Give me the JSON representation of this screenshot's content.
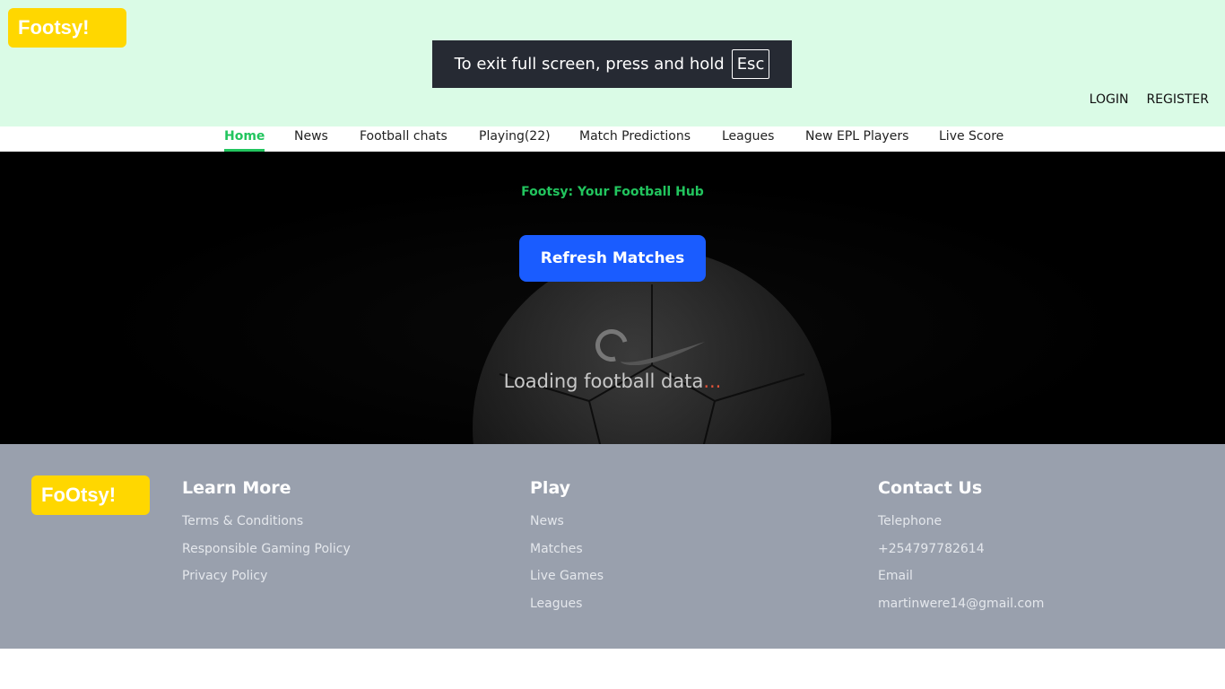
{
  "header": {
    "logo": "Footsy!",
    "fullscreen_notice": "To exit full screen, press and hold",
    "fullscreen_key": "Esc",
    "login": "LOGIN",
    "register": "REGISTER"
  },
  "nav": {
    "items": [
      {
        "label": "Home",
        "active": true
      },
      {
        "label": "News"
      },
      {
        "label": "Football chats"
      },
      {
        "label": "Playing(22)"
      },
      {
        "label": "Match Predictions"
      },
      {
        "label": "Leagues"
      },
      {
        "label": "New EPL Players"
      },
      {
        "label": "Live Score"
      }
    ]
  },
  "hero": {
    "tagline": "Footsy: Your Football Hub",
    "refresh_button": "Refresh Matches",
    "loading_text": "Loading football data",
    "loading_dots": "..."
  },
  "footer": {
    "logo": "FoOtsy!",
    "learn_more": {
      "title": "Learn More",
      "links": [
        "Terms & Conditions",
        "Responsible Gaming Policy",
        "Privacy Policy"
      ]
    },
    "play": {
      "title": "Play",
      "links": [
        "News",
        "Matches",
        "Live Games",
        "Leagues"
      ]
    },
    "contact": {
      "title": "Contact Us",
      "items": [
        "Telephone",
        "+254797782614",
        "Email",
        "martinwere14@gmail.com"
      ]
    }
  },
  "colors": {
    "header_bg": "#dafbe6",
    "logo_bg": "#ffd700",
    "accent_green": "#22c55e",
    "button_blue": "#1a5cff",
    "footer_bg": "#99a0ad"
  }
}
